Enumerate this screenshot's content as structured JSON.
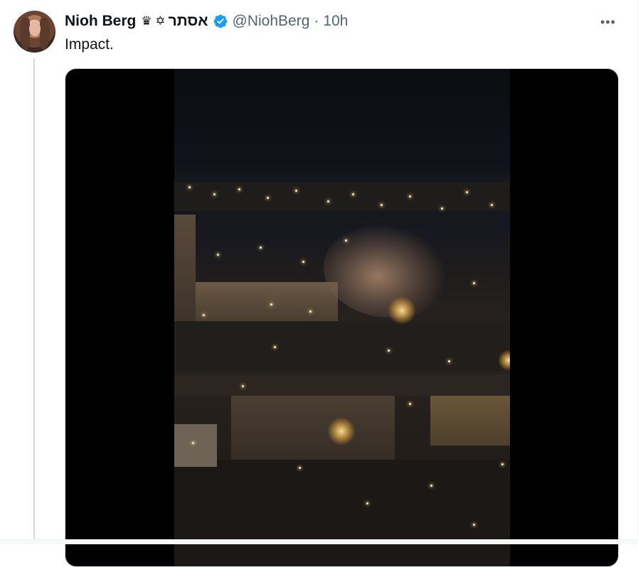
{
  "tweet": {
    "display_name": "Nioh Berg",
    "name_emoji": "♛ ✡",
    "name_hebrew": "אסתר",
    "handle": "@NiohBerg",
    "separator": "·",
    "timestamp": "10h",
    "text": "Impact.",
    "more_label": "•••"
  },
  "colors": {
    "accent": "#1d9bf0",
    "text_primary": "#0f1419",
    "text_secondary": "#536471",
    "thread_line": "#cfd9de"
  },
  "icons": {
    "verified": "verified-badge-icon",
    "more": "more-horizontal-icon"
  }
}
